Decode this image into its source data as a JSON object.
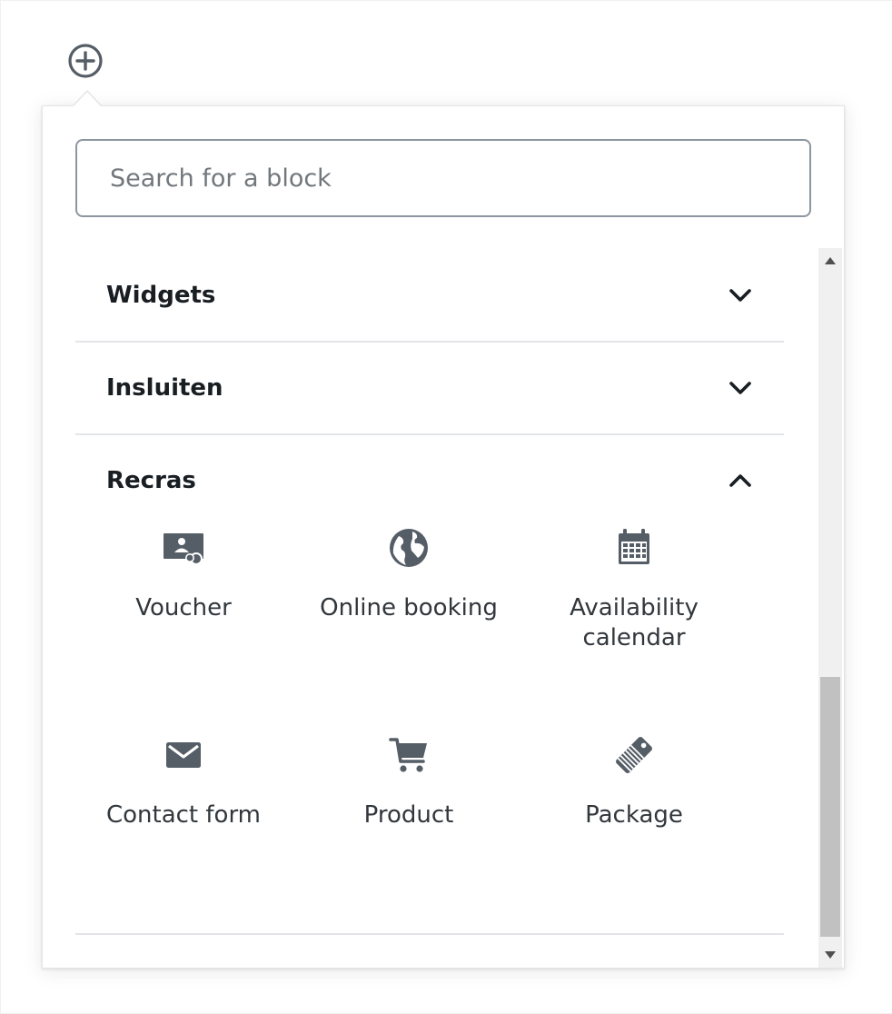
{
  "inserter": {
    "toggle_icon": "plus-circle-icon"
  },
  "search": {
    "placeholder": "Search for a block",
    "value": ""
  },
  "panels": [
    {
      "title": "Widgets",
      "state": "collapsed",
      "icon": "chevron-down-icon"
    },
    {
      "title": "Insluiten",
      "state": "collapsed",
      "icon": "chevron-down-icon"
    },
    {
      "title": "Recras",
      "state": "expanded",
      "icon": "chevron-up-icon"
    }
  ],
  "recras_blocks": [
    {
      "label": "Voucher",
      "icon": "voucher-icon"
    },
    {
      "label": "Online booking",
      "icon": "globe-icon"
    },
    {
      "label": "Availability calendar",
      "icon": "calendar-icon"
    },
    {
      "label": "Contact form",
      "icon": "envelope-icon"
    },
    {
      "label": "Product",
      "icon": "cart-icon"
    },
    {
      "label": "Package",
      "icon": "tag-icon"
    }
  ],
  "colors": {
    "text_primary": "#191e23",
    "icon": "#555d66",
    "border": "#e2e4e7",
    "input_border": "#8d96a0"
  },
  "scrollbar": {
    "position_fraction": 0.62
  }
}
